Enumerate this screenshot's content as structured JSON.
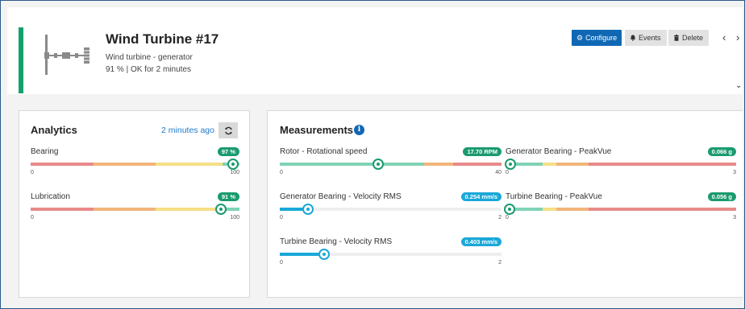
{
  "header": {
    "title": "Wind Turbine #17",
    "subtitle": "Wind turbine - generator",
    "status": "91 % | OK for 2 minutes",
    "status_color": "#16a06a",
    "icon": "wind-turbine-icon",
    "buttons": {
      "configure": "Configure",
      "events": "Events",
      "delete": "Delete"
    },
    "nav": {
      "prev": "‹",
      "next": "›",
      "expand": "⌄"
    }
  },
  "analytics": {
    "title": "Analytics",
    "refresh_label": "2 minutes ago",
    "items": [
      {
        "label": "Bearing",
        "badge": "97 %",
        "min": "0",
        "max": "100",
        "value": 97,
        "range": 100
      },
      {
        "label": "Lubrication",
        "badge": "91 %",
        "min": "0",
        "max": "100",
        "value": 91,
        "range": 100
      }
    ]
  },
  "measurements": {
    "title": "Measurements",
    "left": [
      {
        "label": "Rotor - Rotational speed",
        "badge": "17.70 RPM",
        "min": "0",
        "max": "40",
        "value": 17.7,
        "range": 40
      },
      {
        "label": "Generator Bearing - Velocity RMS",
        "badge": "0.254 mm/s",
        "min": "0",
        "max": "2",
        "value": 0.254,
        "range": 2
      },
      {
        "label": "Turbine Bearing - Velocity RMS",
        "badge": "0.403 mm/s",
        "min": "0",
        "max": "2",
        "value": 0.403,
        "range": 2
      }
    ],
    "right": [
      {
        "label": "Generator Bearing - PeakVue",
        "badge": "0.066 g",
        "min": "0",
        "max": "3",
        "value": 0.066,
        "range": 3
      },
      {
        "label": "Turbine Bearing - PeakVue",
        "badge": "0.056 g",
        "min": "0",
        "max": "3",
        "value": 0.056,
        "range": 3
      }
    ]
  },
  "colors": {
    "green": "#1a9b6e",
    "blue": "#1aa8d8",
    "red": "#e88a8a",
    "orange": "#f1b57a",
    "yellow": "#f5df86",
    "teal": "#7fd3b4",
    "accent": "#1068b5"
  }
}
